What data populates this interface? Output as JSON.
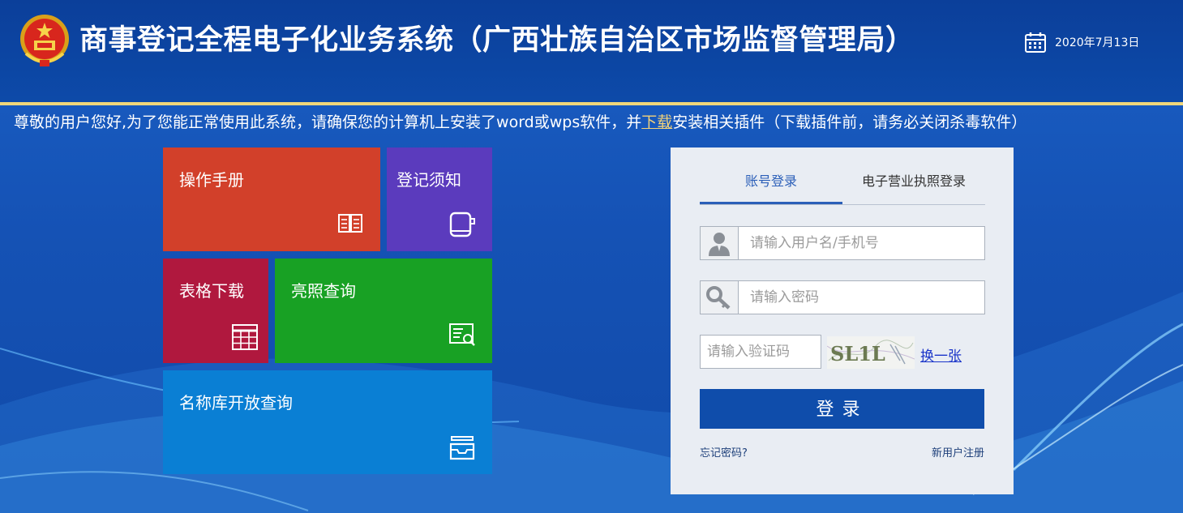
{
  "header": {
    "title": "商事登记全程电子化业务系统（广西壮族自治区市场监督管理局）",
    "date": "2020年7月13日"
  },
  "notice": {
    "before": "尊敬的用户您好,为了您能正常使用此系统，请确保您的计算机上安装了word或wps软件，并",
    "link": "下载",
    "after": "安装相关插件（下载插件前，请务必关闭杀毒软件）"
  },
  "tiles": {
    "manual": "操作手册",
    "registration_notice": "登记须知",
    "form_download": "表格下载",
    "license_query": "亮照查询",
    "name_library_query": "名称库开放查询"
  },
  "login": {
    "tab_account": "账号登录",
    "tab_license": "电子营业执照登录",
    "username_placeholder": "请输入用户名/手机号",
    "password_placeholder": "请输入密码",
    "captcha_placeholder": "请输入验证码",
    "captcha_text": "SL1L",
    "refresh_label": "换一张",
    "login_label": "登录",
    "forgot_label": "忘记密码?",
    "register_label": "新用户注册"
  },
  "colors": {
    "header_bg": "#0d4aa9",
    "accent_line": "#f0d77b",
    "tile_manual": "#d2402a",
    "tile_notice": "#5b3bbd",
    "tile_forms": "#b0183e",
    "tile_license": "#18a124",
    "tile_names": "#0a7fd4",
    "login_button": "#0f4dab"
  }
}
